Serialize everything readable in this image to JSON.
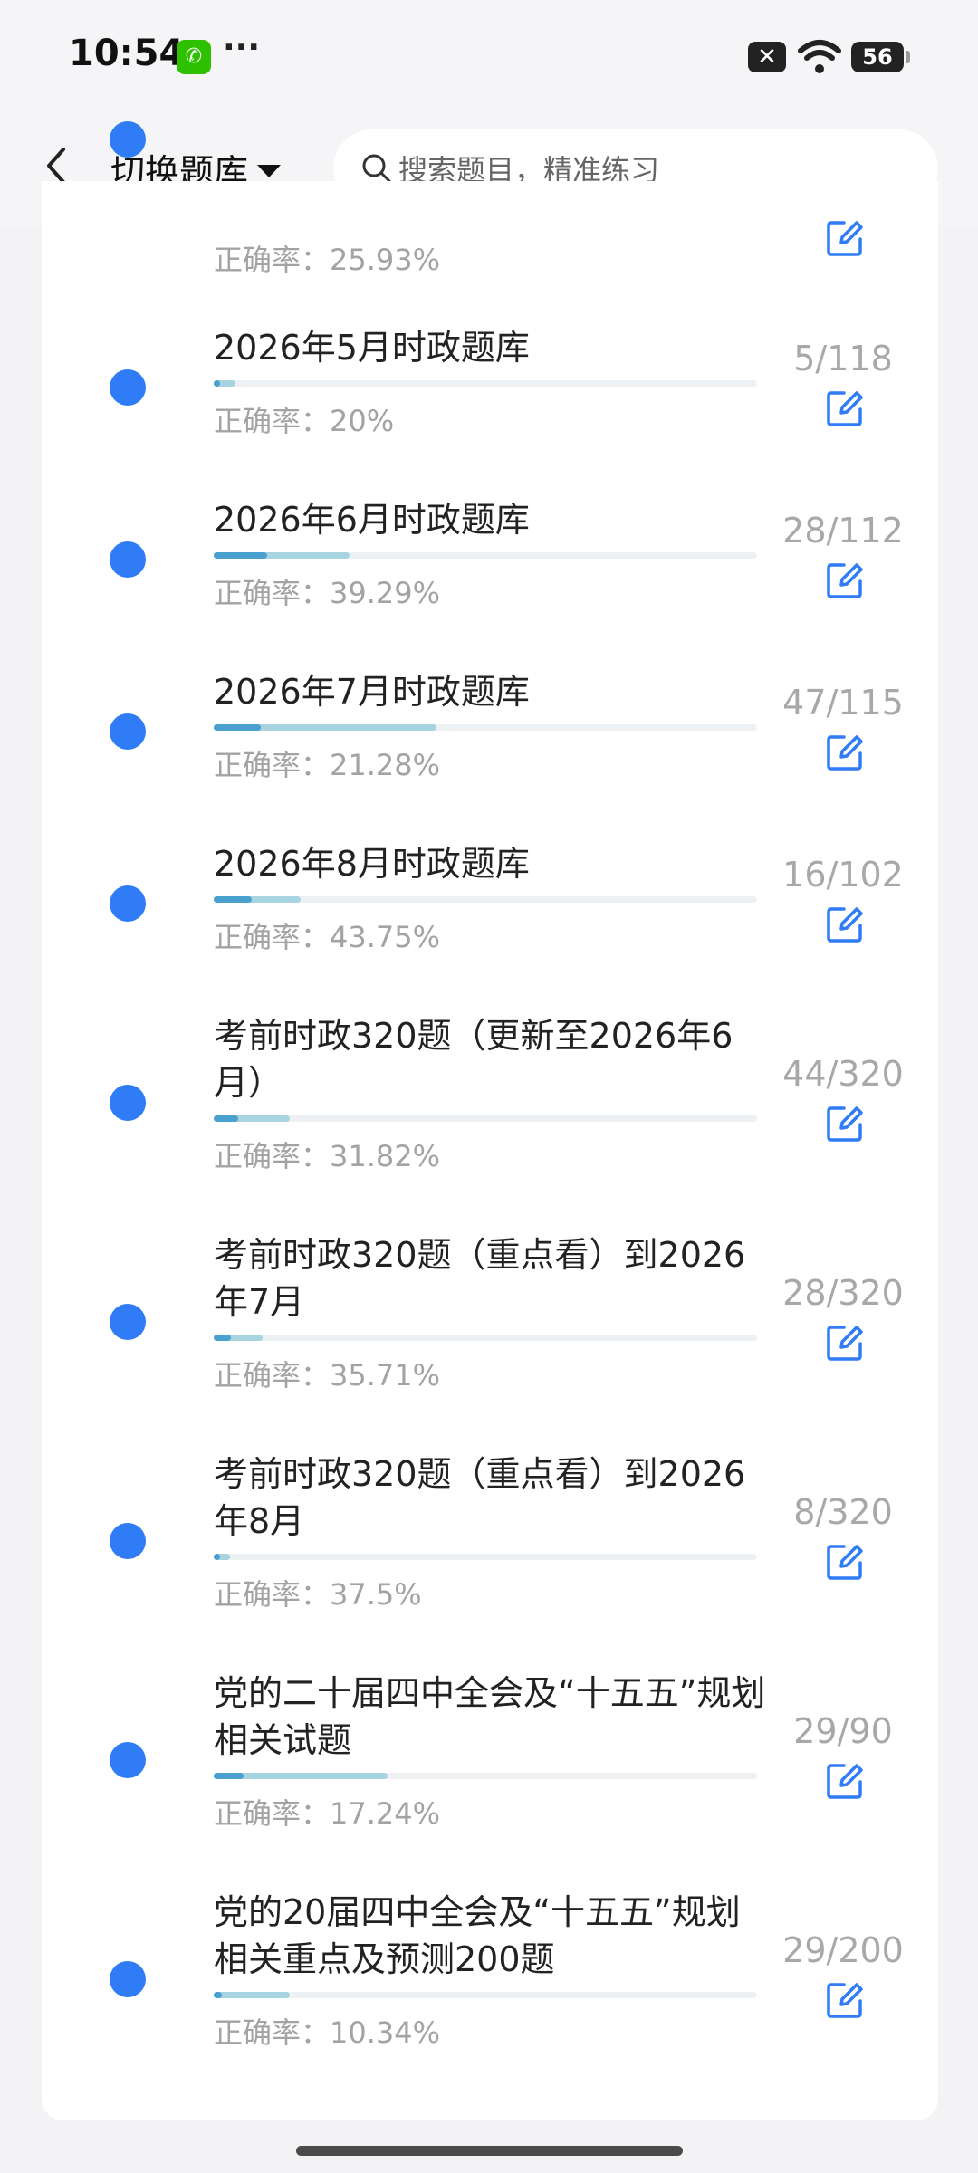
{
  "status": {
    "time": "10:54",
    "battery": "56",
    "more": "···"
  },
  "header": {
    "switch_label": "切换题库",
    "search_placeholder": "搜索题目，精准练习"
  },
  "top_partial": {
    "rate_label": "正确率：",
    "rate": "25.93%"
  },
  "items": [
    {
      "title": "2026年5月时政题库",
      "count": "5/118",
      "rate_label": "正确率：",
      "rate": "20%",
      "progress": 0.04,
      "progress_correct": 0.2
    },
    {
      "title": "2026年6月时政题库",
      "count": "28/112",
      "rate_label": "正确率：",
      "rate": "39.29%",
      "progress": 0.25,
      "progress_correct": 0.3929
    },
    {
      "title": "2026年7月时政题库",
      "count": "47/115",
      "rate_label": "正确率：",
      "rate": "21.28%",
      "progress": 0.41,
      "progress_correct": 0.2128
    },
    {
      "title": "2026年8月时政题库",
      "count": "16/102",
      "rate_label": "正确率：",
      "rate": "43.75%",
      "progress": 0.16,
      "progress_correct": 0.4375
    },
    {
      "title": "考前时政320题（更新至2026年6月）",
      "count": "44/320",
      "rate_label": "正确率：",
      "rate": "31.82%",
      "progress": 0.14,
      "progress_correct": 0.3182
    },
    {
      "title": "考前时政320题（重点看）到2026年7月",
      "count": "28/320",
      "rate_label": "正确率：",
      "rate": "35.71%",
      "progress": 0.09,
      "progress_correct": 0.3571
    },
    {
      "title": "考前时政320题（重点看）到2026年8月",
      "count": "8/320",
      "rate_label": "正确率：",
      "rate": "37.5%",
      "progress": 0.03,
      "progress_correct": 0.375
    },
    {
      "title": "党的二十届四中全会及“十五五”规划相关试题",
      "count": "29/90",
      "rate_label": "正确率：",
      "rate": "17.24%",
      "progress": 0.32,
      "progress_correct": 0.1724
    },
    {
      "title": "党的20届四中全会及“十五五”规划相关重点及预测200题",
      "count": "29/200",
      "rate_label": "正确率：",
      "rate": "10.34%",
      "progress": 0.14,
      "progress_correct": 0.1034
    }
  ]
}
